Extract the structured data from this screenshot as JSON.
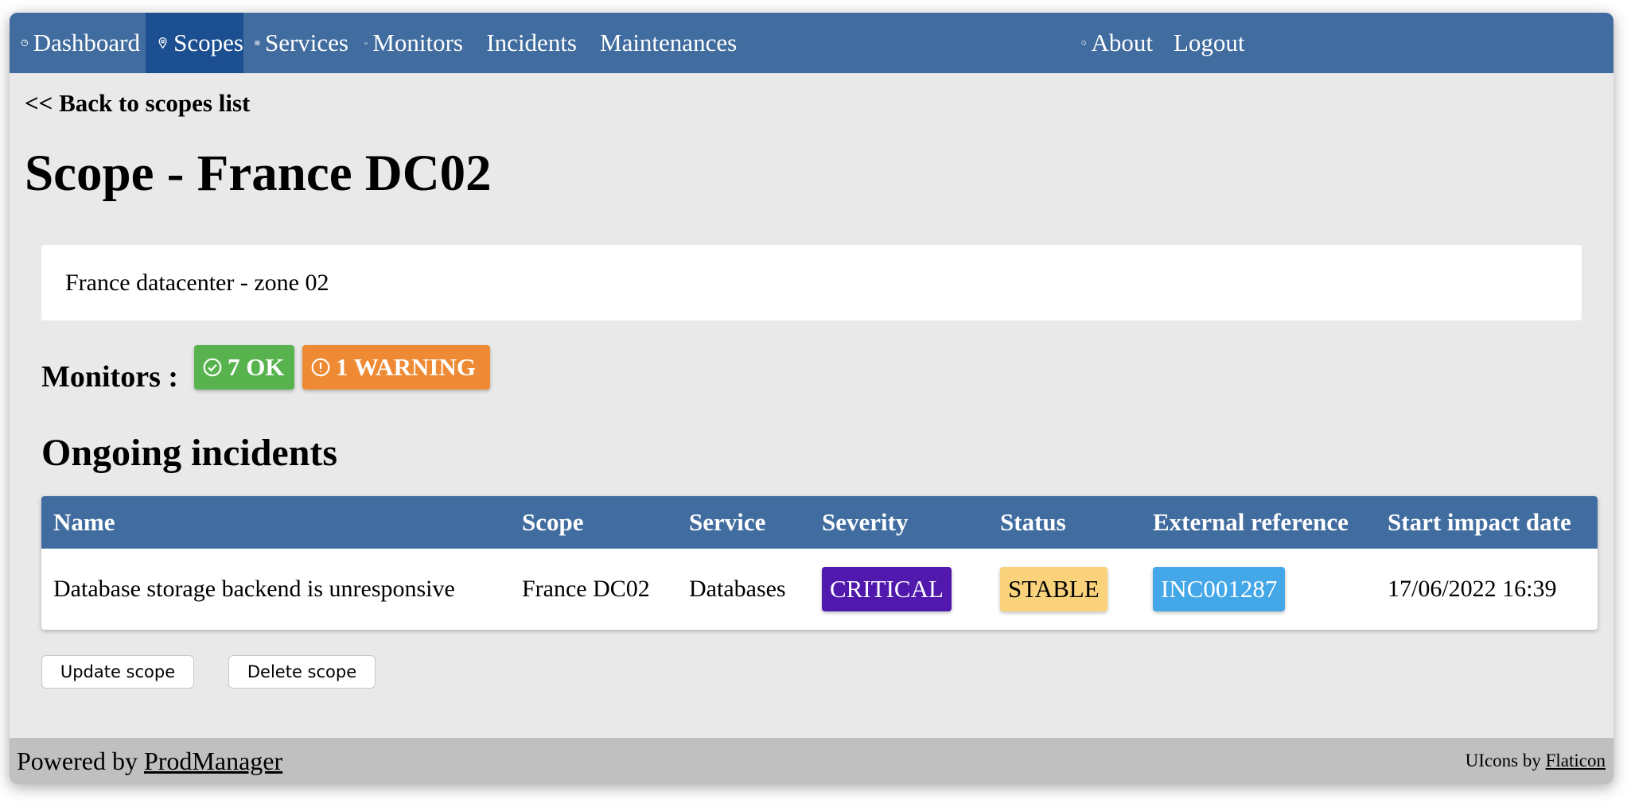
{
  "nav": {
    "items": [
      {
        "label": "Dashboard",
        "icon": "gauge-icon",
        "active": false
      },
      {
        "label": "Scopes",
        "icon": "map-pin-icon",
        "active": true
      },
      {
        "label": "Services",
        "icon": "grid-icon",
        "active": false
      },
      {
        "label": "Monitors",
        "icon": "chart-bar-icon",
        "active": false
      },
      {
        "label": "Incidents",
        "icon": "shield-icon",
        "active": false
      },
      {
        "label": "Maintenances",
        "icon": "list-icon",
        "active": false
      }
    ],
    "about_label": "About",
    "logout_label": "Logout"
  },
  "back_link": "<< Back to scopes list",
  "page_title": "Scope - France DC02",
  "description": "France datacenter - zone 02",
  "monitors": {
    "label": "Monitors :",
    "ok_badge": "7 OK",
    "warning_badge": "1 WARNING"
  },
  "incidents": {
    "title": "Ongoing incidents",
    "columns": [
      "Name",
      "Scope",
      "Service",
      "Severity",
      "Status",
      "External reference",
      "Start impact date"
    ],
    "rows": [
      {
        "name": "Database storage backend is unresponsive",
        "scope": "France DC02",
        "service": "Databases",
        "severity": "CRITICAL",
        "status": "STABLE",
        "external_reference": "INC001287",
        "start_impact_date": "17/06/2022 16:39"
      }
    ]
  },
  "actions": {
    "update_label": "Update scope",
    "delete_label": "Delete scope"
  },
  "footer": {
    "powered_prefix": "Powered by",
    "powered_link": "ProdManager",
    "icons_prefix": "UIcons by",
    "icons_link": "Flaticon"
  },
  "colors": {
    "nav_bg": "#416c9f",
    "nav_active_bg": "#1c4f92",
    "ok": "#58b34f",
    "warning": "#ef8a34",
    "critical": "#5018ad",
    "stable": "#f9d27b",
    "reference": "#43a7e8"
  }
}
